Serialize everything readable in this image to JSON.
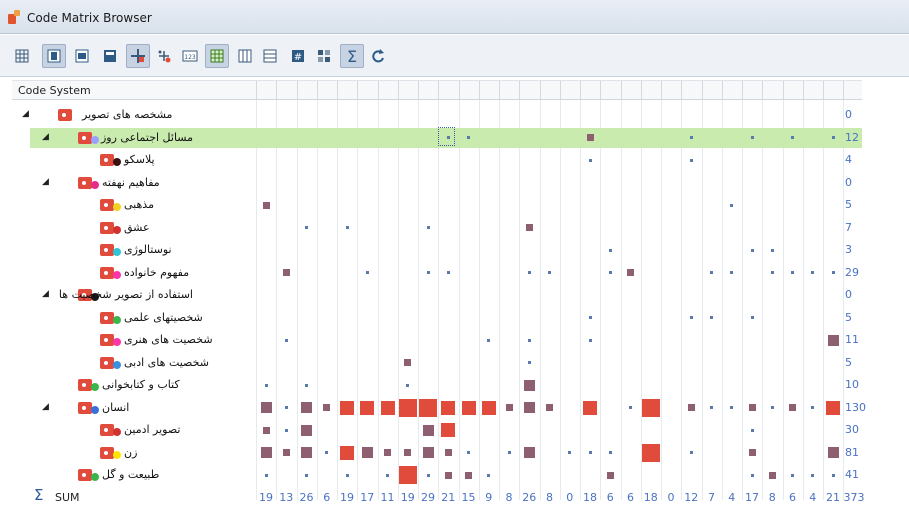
{
  "window": {
    "title": "Code Matrix Browser"
  },
  "toolbar": {
    "buttons": [
      {
        "name": "grid-view-icon",
        "active": false
      },
      {
        "name": "column-layout-icon",
        "active": true
      },
      {
        "name": "document-view-icon",
        "active": false
      },
      {
        "name": "single-column-icon",
        "active": false
      },
      {
        "name": "code-color-icon",
        "active": true
      },
      {
        "name": "code-nodes-icon",
        "active": false
      },
      {
        "name": "numbers-icon",
        "active": false
      },
      {
        "name": "table-view-icon",
        "active": true
      },
      {
        "name": "columns-icon",
        "active": false
      },
      {
        "name": "rows-icon",
        "active": false
      },
      {
        "name": "hash-icon",
        "active": false
      },
      {
        "name": "grid-dots-icon",
        "active": false
      },
      {
        "name": "sigma-icon",
        "active": true
      },
      {
        "name": "refresh-icon",
        "active": false
      }
    ]
  },
  "header": {
    "code_system": "Code System"
  },
  "colors": {
    "red": "#e14b3b",
    "purple": "#8e5f71",
    "blue": "#4a72c4",
    "selected": "#c9ebae"
  },
  "codes": [
    {
      "label": "مشخصه های تصویر",
      "level": 0,
      "expand": true,
      "dot": "",
      "total": "0",
      "cells": {}
    },
    {
      "label": "مسائل اجتماعی روز",
      "level": 1,
      "expand": true,
      "dot": "#9aa0ff",
      "total": "12",
      "selected": true,
      "cells": {
        "9": 1,
        "10": 1,
        "16": 2,
        "21": 1,
        "24": 1,
        "26": 1,
        "28": 1
      }
    },
    {
      "label": "پلاسکو",
      "level": 2,
      "expand": false,
      "dot": "#3a1010",
      "total": "4",
      "cells": {
        "16": 1,
        "21": 1
      }
    },
    {
      "label": "مفاهیم نهفته",
      "level": 1,
      "expand": true,
      "dot": "#e62b8a",
      "total": "0",
      "cells": {}
    },
    {
      "label": "مذهبی",
      "level": 2,
      "expand": false,
      "dot": "#f0d21f",
      "total": "5",
      "cells": {
        "0": 2,
        "23": 1
      }
    },
    {
      "label": "عشق",
      "level": 2,
      "expand": false,
      "dot": "#d33030",
      "total": "7",
      "cells": {
        "2": 1,
        "4": 1,
        "8": 1,
        "13": 2
      }
    },
    {
      "label": "نوستالوژی",
      "level": 2,
      "expand": false,
      "dot": "#30c5d6",
      "total": "3",
      "cells": {
        "17": 1,
        "24": 1,
        "25": 1
      }
    },
    {
      "label": "مفهوم خانواده",
      "level": 2,
      "expand": false,
      "dot": "#ff33aa",
      "total": "29",
      "cells": {
        "1": 2,
        "5": 1,
        "8": 1,
        "9": 1,
        "13": 1,
        "14": 1,
        "17": 1,
        "18": 2,
        "22": 1,
        "23": 1,
        "25": 1,
        "26": 1,
        "27": 1,
        "28": 1
      }
    },
    {
      "label": "استفاده از تصویر شخصیت ها",
      "level": 1,
      "expand": true,
      "dot": "#1a1a1a",
      "total": "0",
      "cells": {}
    },
    {
      "label": "شخصیتهای علمی",
      "level": 2,
      "expand": false,
      "dot": "#3ab54a",
      "total": "5",
      "cells": {
        "16": 1,
        "21": 1,
        "22": 1,
        "24": 1
      }
    },
    {
      "label": "شخصیت های هنری",
      "level": 2,
      "expand": false,
      "dot": "#ff33aa",
      "total": "11",
      "cells": {
        "1": 1,
        "11": 1,
        "13": 1,
        "16": 1,
        "28": 3
      }
    },
    {
      "label": "شخصیت های ادبی",
      "level": 2,
      "expand": false,
      "dot": "#3a8fe0",
      "total": "5",
      "cells": {
        "7": 2,
        "13": 1
      }
    },
    {
      "label": "کتاب و کتابخوانی",
      "level": 1,
      "expand": false,
      "dot": "#3ab54a",
      "total": "10",
      "cells": {
        "0": 1,
        "2": 1,
        "7": 1,
        "13": 3
      }
    },
    {
      "label": "انسان",
      "level": 1,
      "expand": true,
      "dot": "#3a6fd8",
      "total": "130",
      "cells": {
        "0": 3,
        "1": 1,
        "2": 3,
        "3": 2,
        "4": 4,
        "5": 4,
        "6": 4,
        "7": 5,
        "8": 5,
        "9": 4,
        "10": 4,
        "11": 4,
        "12": 2,
        "13": 3,
        "14": 2,
        "16": 4,
        "18": 1,
        "19": 5,
        "21": 2,
        "22": 1,
        "23": 1,
        "24": 2,
        "25": 1,
        "26": 2,
        "27": 1,
        "28": 4
      }
    },
    {
      "label": "تصویر ادمین",
      "level": 2,
      "expand": false,
      "dot": "#d33030",
      "total": "30",
      "cells": {
        "0": 2,
        "1": 1,
        "2": 3,
        "8": 3,
        "9": 4,
        "24": 1
      }
    },
    {
      "label": "زن",
      "level": 2,
      "expand": false,
      "dot": "#ffe600",
      "total": "81",
      "cells": {
        "0": 3,
        "1": 2,
        "2": 3,
        "3": 1,
        "4": 4,
        "5": 3,
        "6": 2,
        "7": 2,
        "8": 3,
        "9": 2,
        "10": 1,
        "12": 1,
        "13": 3,
        "15": 1,
        "16": 1,
        "17": 1,
        "19": 5,
        "21": 1,
        "24": 2,
        "28": 3
      }
    },
    {
      "label": "طبیعت و گل",
      "level": 1,
      "expand": false,
      "dot": "#3ab54a",
      "total": "41",
      "cells": {
        "0": 1,
        "2": 1,
        "4": 1,
        "6": 1,
        "7": 5,
        "8": 1,
        "9": 2,
        "10": 2,
        "11": 1,
        "17": 2,
        "24": 1,
        "25": 2,
        "26": 1,
        "27": 1,
        "28": 1
      }
    }
  ],
  "sum": {
    "label": "SUM",
    "values": [
      "19",
      "13",
      "26",
      "6",
      "19",
      "17",
      "11",
      "19",
      "29",
      "21",
      "15",
      "9",
      "8",
      "26",
      "8",
      "0",
      "18",
      "6",
      "6",
      "18",
      "0",
      "12",
      "7",
      "4",
      "17",
      "8",
      "6",
      "4",
      "21"
    ],
    "total": "373"
  }
}
